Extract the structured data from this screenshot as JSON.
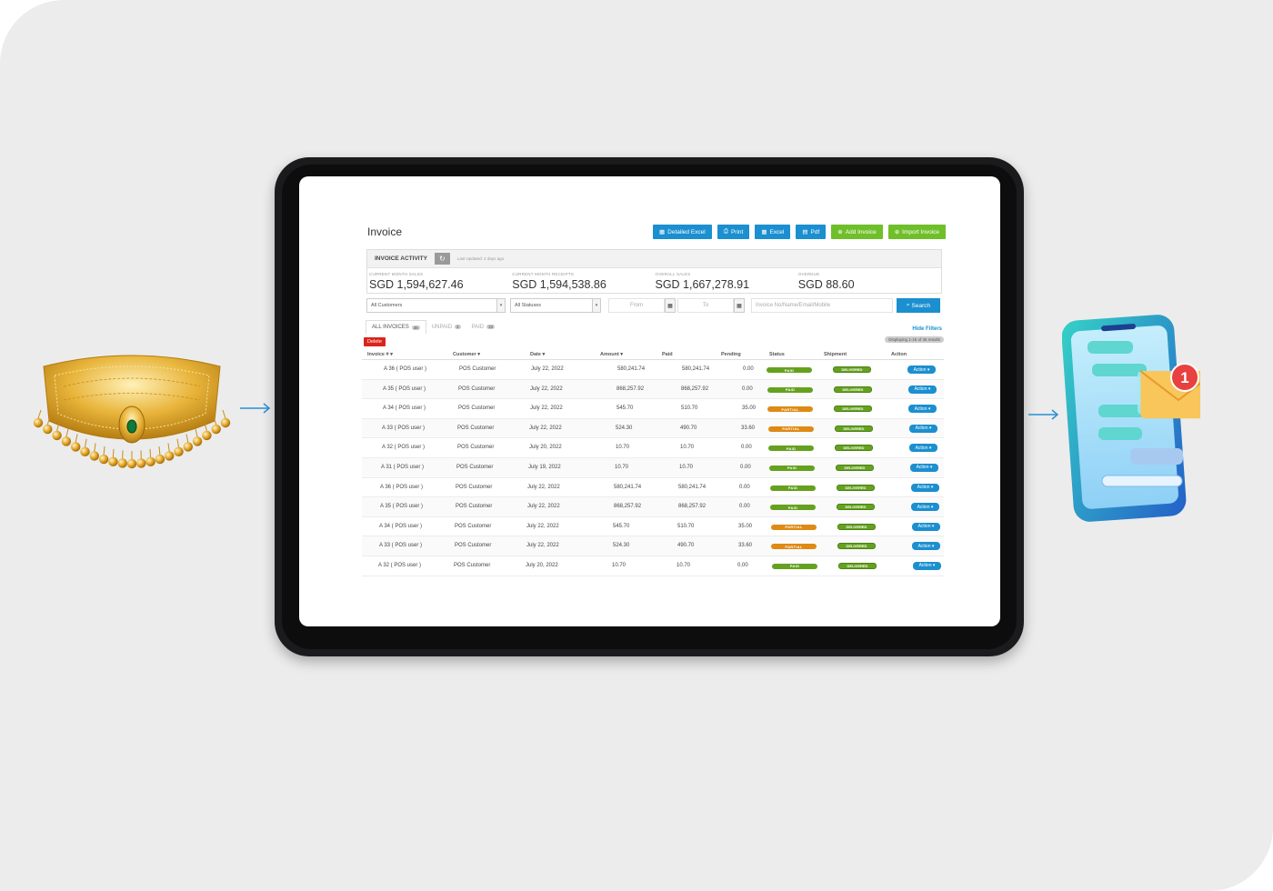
{
  "colors": {
    "background": "#ececec",
    "primary_blue": "#1b8fcf",
    "green": "#6fbf2a",
    "paid": "#65a11f",
    "partial": "#de8a14",
    "delete": "#d9261c",
    "gold": "#e0a92a"
  },
  "app": {
    "title": "Invoice",
    "toolbar": [
      {
        "label": "Detailed Excel",
        "icon": "spreadsheet-icon",
        "style": "blue"
      },
      {
        "label": "Print",
        "icon": "printer-icon",
        "style": "blue"
      },
      {
        "label": "Excel",
        "icon": "spreadsheet-icon",
        "style": "blue"
      },
      {
        "label": "Pdf",
        "icon": "pdf-icon",
        "style": "blue"
      },
      {
        "label": "Add Invoice",
        "icon": "plus-circle-icon",
        "style": "green"
      },
      {
        "label": "Import Invoice",
        "icon": "plus-circle-icon",
        "style": "green"
      }
    ],
    "activity": {
      "title": "INVOICE ACTIVITY",
      "last_updated": "Last Updated: 2 days ago",
      "stats": [
        {
          "label": "CURRENT MONTH SALES",
          "value": "SGD 1,594,627.46"
        },
        {
          "label": "CURRENT MONTH RECEIPTS",
          "value": "SGD 1,594,538.86"
        },
        {
          "label": "OVERALL SALES",
          "value": "SGD 1,667,278.91"
        },
        {
          "label": "OVERDUE",
          "value": "SGD 88.60"
        }
      ]
    },
    "filters": {
      "customers": "All Customers",
      "statuses": "All Statuses",
      "from_placeholder": "From",
      "to_placeholder": "To",
      "search_placeholder": "Invoice No/Name/Email/Mobile",
      "search_button": "Search"
    },
    "tabs": [
      {
        "label": "ALL INVOICES",
        "count": "36"
      },
      {
        "label": "UNPAID",
        "count": "3"
      },
      {
        "label": "PAID",
        "count": "33"
      }
    ],
    "hide_filters": "Hide Filters",
    "displaying": "Displaying 1-15 of 36 results",
    "delete_label": "Delete",
    "columns": [
      "Invoice # ▾",
      "Customer ▾",
      "Date ▾",
      "Amount ▾",
      "Paid",
      "Pending",
      "Status",
      "Shipment",
      "Action"
    ],
    "rows": [
      {
        "invoice": "A 36 ( POS user )",
        "customer": "POS Customer",
        "date": "July 22, 2022",
        "amount": "580,241.74",
        "paid": "580,241.74",
        "pending": "0.00",
        "status": "PAID",
        "shipment": "DELIVERED",
        "action": "Action ▾"
      },
      {
        "invoice": "A 35 ( POS user )",
        "customer": "POS Customer",
        "date": "July 22, 2022",
        "amount": "868,257.92",
        "paid": "868,257.92",
        "pending": "0.00",
        "status": "PAID",
        "shipment": "DELIVERED",
        "action": "Action ▾"
      },
      {
        "invoice": "A 34 ( POS user )",
        "customer": "POS Customer",
        "date": "July 22, 2022",
        "amount": "545.70",
        "paid": "510.70",
        "pending": "35.00",
        "status": "PARTIAL",
        "shipment": "DELIVERED",
        "action": "Action ▾"
      },
      {
        "invoice": "A 33 ( POS user )",
        "customer": "POS Customer",
        "date": "July 22, 2022",
        "amount": "524.30",
        "paid": "490.70",
        "pending": "33.60",
        "status": "PARTIAL",
        "shipment": "DELIVERED",
        "action": "Action ▾"
      },
      {
        "invoice": "A 32 ( POS user )",
        "customer": "POS Customer",
        "date": "July 20, 2022",
        "amount": "10.70",
        "paid": "10.70",
        "pending": "0.00",
        "status": "PAID",
        "shipment": "DELIVERED",
        "action": "Action ▾"
      },
      {
        "invoice": "A 31 ( POS user )",
        "customer": "POS Customer",
        "date": "July 19, 2022",
        "amount": "10.70",
        "paid": "10.70",
        "pending": "0.00",
        "status": "PAID",
        "shipment": "DELIVERED",
        "action": "Action ▾"
      },
      {
        "invoice": "A 36 ( POS user )",
        "customer": "POS Customer",
        "date": "July 22, 2022",
        "amount": "580,241.74",
        "paid": "580,241.74",
        "pending": "0.00",
        "status": "PAID",
        "shipment": "DELIVERED",
        "action": "Action ▾"
      },
      {
        "invoice": "A 35 ( POS user )",
        "customer": "POS Customer",
        "date": "July 22, 2022",
        "amount": "868,257.92",
        "paid": "868,257.92",
        "pending": "0.00",
        "status": "PAID",
        "shipment": "DELIVERED",
        "action": "Action ▾"
      },
      {
        "invoice": "A 34 ( POS user )",
        "customer": "POS Customer",
        "date": "July 22, 2022",
        "amount": "545.70",
        "paid": "510.70",
        "pending": "35.00",
        "status": "PARTIAL",
        "shipment": "DELIVERED",
        "action": "Action ▾"
      },
      {
        "invoice": "A 33 ( POS user )",
        "customer": "POS Customer",
        "date": "July 22, 2022",
        "amount": "524.30",
        "paid": "490.70",
        "pending": "33.60",
        "status": "PARTIAL",
        "shipment": "DELIVERED",
        "action": "Action ▾"
      },
      {
        "invoice": "A 32 ( POS user )",
        "customer": "POS Customer",
        "date": "July 20, 2022",
        "amount": "10.70",
        "paid": "10.70",
        "pending": "0.00",
        "status": "PAID",
        "shipment": "DELIVERED",
        "action": "Action ▾"
      }
    ]
  },
  "phone": {
    "notification_count": "1",
    "icon": "envelope-icon"
  },
  "decor": {
    "left_image": "necklace-illustration",
    "arrows": [
      "arrow-right-icon",
      "arrow-right-icon"
    ]
  }
}
